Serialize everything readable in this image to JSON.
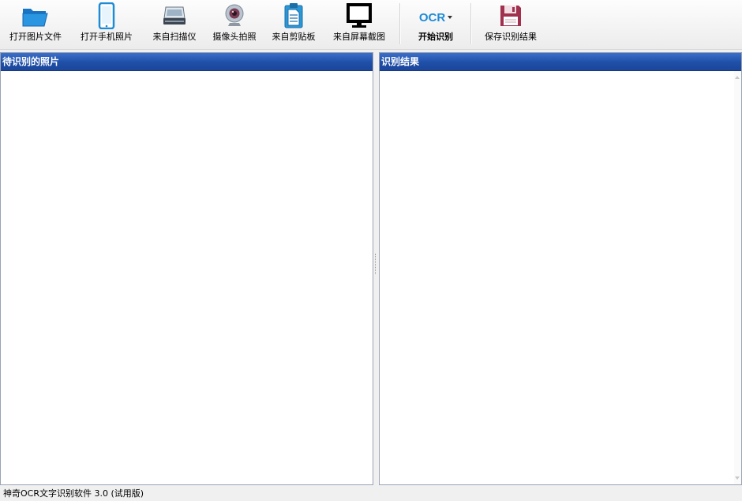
{
  "toolbar": {
    "buttons": [
      {
        "label": "打开图片文件",
        "icon": "folder-open-icon"
      },
      {
        "label": "打开手机照片",
        "icon": "phone-icon"
      },
      {
        "label": "来自扫描仪",
        "icon": "scanner-icon"
      },
      {
        "label": "摄像头拍照",
        "icon": "webcam-icon"
      },
      {
        "label": "来自剪贴板",
        "icon": "clipboard-icon"
      },
      {
        "label": "来自屏幕截图",
        "icon": "monitor-icon"
      },
      {
        "label": "开始识别",
        "icon": "ocr-icon",
        "icon_text": "OCR"
      },
      {
        "label": "保存识别结果",
        "icon": "floppy-disk-icon"
      }
    ]
  },
  "left_panel": {
    "title": "待识别的照片"
  },
  "right_panel": {
    "title": "识别结果"
  },
  "status": {
    "text": "神奇OCR文字识别软件 3.0 (试用版)"
  },
  "colors": {
    "header_blue": "#1f4fa8",
    "icon_blue": "#1e8bd6",
    "floppy_red": "#a0304e"
  }
}
